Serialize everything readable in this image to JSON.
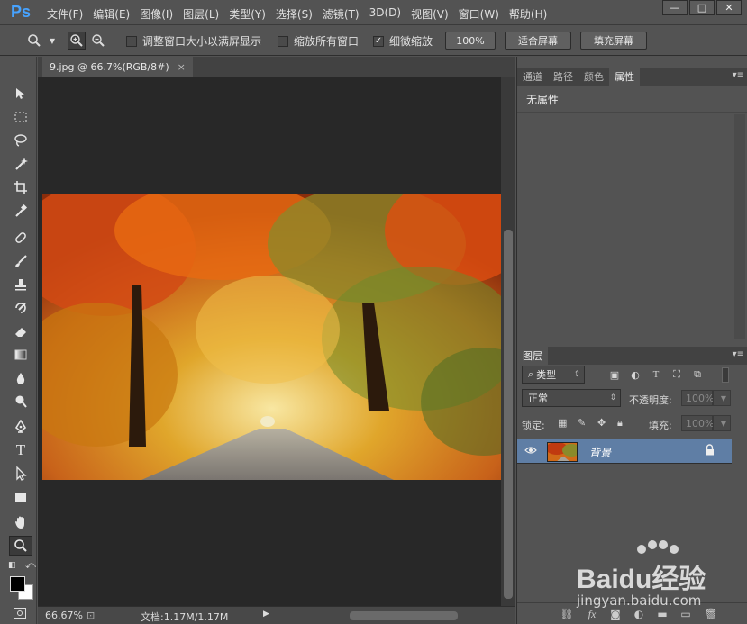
{
  "app": {
    "logo": "Ps"
  },
  "menubar": {
    "items": [
      "文件(F)",
      "编辑(E)",
      "图像(I)",
      "图层(L)",
      "类型(Y)",
      "选择(S)",
      "滤镜(T)",
      "3D(D)",
      "视图(V)",
      "窗口(W)",
      "帮助(H)"
    ],
    "window_controls": {
      "minimize": "—",
      "maximize": "□",
      "close": "✕"
    }
  },
  "options_bar": {
    "resize_windows_label": "调整窗口大小以满屏显示",
    "resize_windows_checked": false,
    "zoom_all_label": "缩放所有窗口",
    "zoom_all_checked": false,
    "scrubby_zoom_label": "细微缩放",
    "scrubby_zoom_checked": true,
    "percent_button": "100%",
    "fit_screen_button": "适合屏幕",
    "fill_screen_button": "填充屏幕"
  },
  "document": {
    "tab_title": "9.jpg @ 66.7%(RGB/8#)",
    "tab_close": "×",
    "zoom": "66.67%",
    "doc_info": "文档:1.17M/1.17M"
  },
  "properties_panel": {
    "tabs": [
      "通道",
      "路径",
      "颜色",
      "属性"
    ],
    "active_tab": "属性",
    "empty_text": "无属性"
  },
  "layers_panel": {
    "tab": "图层",
    "filter_kind": "类型",
    "blend_mode": "正常",
    "opacity_label": "不透明度:",
    "opacity_value": "100%",
    "lock_label": "锁定:",
    "fill_label": "填充:",
    "fill_value": "100%",
    "layers": [
      {
        "name": "背景",
        "visible": true,
        "locked": true
      }
    ]
  },
  "watermark": {
    "brand": "Baidu经验",
    "url": "jingyan.baidu.com"
  },
  "colors": {
    "foreground": "#000000",
    "background": "#ffffff",
    "selected_layer": "#5f7ea5"
  }
}
